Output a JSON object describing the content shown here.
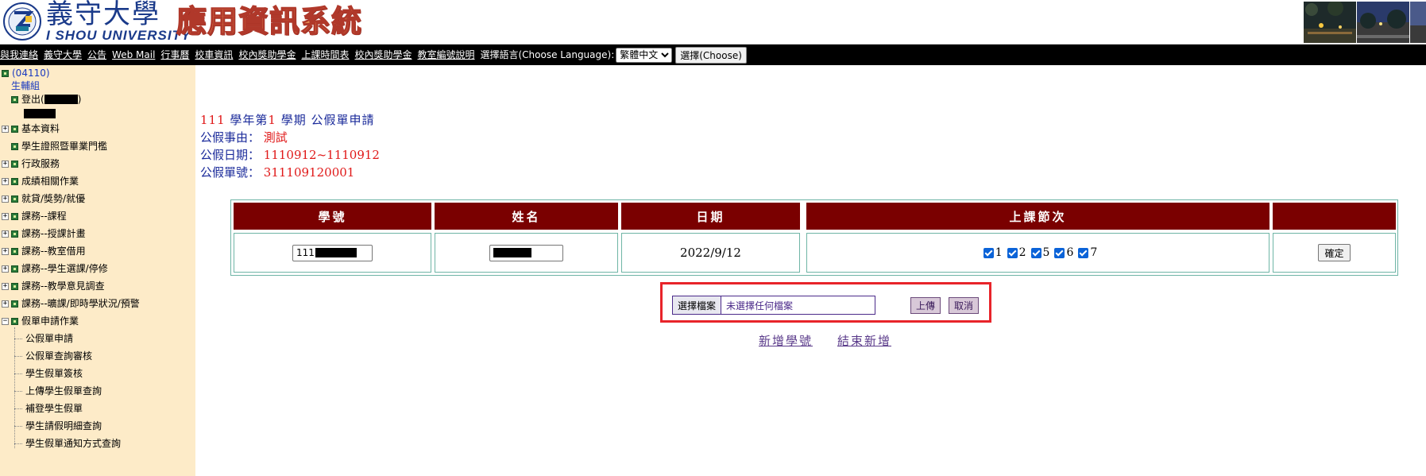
{
  "header": {
    "university_name": "義守大學",
    "university_name_en": "I SHOU UNIVERSITY",
    "system_title": "應用資訊系統"
  },
  "nav": {
    "links": [
      "與我連絡",
      "義守大學",
      "公告",
      "Web Mail",
      "行事曆",
      "校車資訊",
      "校內獎助學金",
      "上課時間表",
      "校內獎助學金",
      "教室編號說明"
    ],
    "language_label": "選擇語言(Choose Language):",
    "language_selected": "繁體中文",
    "choose_button": "選擇(Choose)"
  },
  "sidebar": {
    "user_code": "(04110)",
    "dept": "生輔組",
    "logout": "登出(",
    "logout_suffix": ")",
    "menus": [
      "基本資料",
      "學生證照暨畢業門檻",
      "行政服務",
      "成績相關作業",
      "就貸/獎勢/就優",
      "課務--課程",
      "課務--授課計畫",
      "課務--教室借用",
      "課務--學生選課/停修",
      "課務--教學意見調查",
      "課務--曠課/即時學狀況/預警"
    ],
    "open_menu": "假單申請作業",
    "sub_items": [
      "公假單申請",
      "公假單查詢審核",
      "學生假單簽核",
      "上傳學生假單查詢",
      "補登學生假單",
      "學生請假明細查詢",
      "學生假單通知方式查詢"
    ]
  },
  "info": {
    "year": "111",
    "title_mid": " 學年第",
    "semester": "1",
    "title_end": " 學期 公假單申請",
    "reason_label": "公假事由：",
    "reason_value": "測試",
    "date_label": "公假日期：",
    "date_value": "1110912~1110912",
    "form_no_label": "公假單號：",
    "form_no_value": "311109120001"
  },
  "table": {
    "headers": {
      "student_id": "學號",
      "name": "姓名",
      "date": "日期",
      "periods": "上課節次",
      "action": ""
    },
    "row": {
      "student_id_prefix": "111",
      "date": "2022/9/12",
      "periods": [
        "1",
        "2",
        "5",
        "6",
        "7"
      ],
      "confirm": "確定"
    }
  },
  "upload": {
    "choose_file": "選擇檔案",
    "no_file": "未選擇任何檔案",
    "upload_button": "上傳",
    "cancel_button": "取消"
  },
  "bottom": {
    "add_student": "新增學號",
    "finish_add": "結束新增"
  }
}
